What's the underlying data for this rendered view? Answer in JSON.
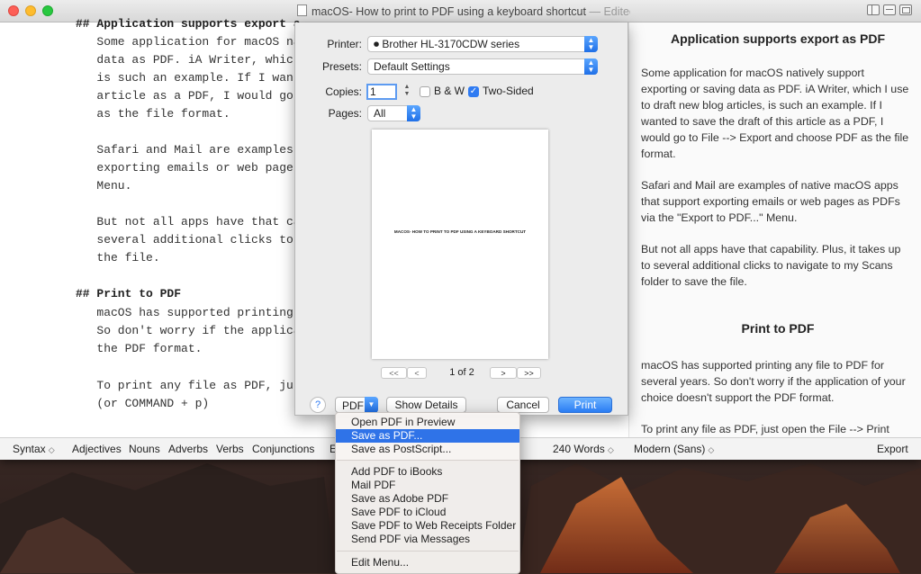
{
  "window": {
    "title": "macOS- How to print to PDF using a keyboard shortcut",
    "edited_status": "— Edited ⌄"
  },
  "editor": {
    "lines": [
      "## Application supports export a",
      "   Some application for macOS nat",
      "   data as PDF. iA Writer, which",
      "   is such an example. If I wante",
      "   article as a PDF, I would go t",
      "   as the file format.",
      "",
      "   Safari and Mail are examples o",
      "   exporting emails or web pages",
      "   Menu.",
      "",
      "   But not all apps have that cap",
      "   several additional clicks to n",
      "   the file.",
      "",
      "## Print to PDF",
      "   macOS has supported printing a",
      "   So don't worry if the applicat",
      "   the PDF format.",
      "",
      "   To print any file as PDF, just",
      "   (or COMMAND + p)"
    ]
  },
  "preview": {
    "heading1": "Application supports export as PDF",
    "para1": "Some application for macOS natively support exporting or saving data as PDF. iA Writer, which I use to draft new blog articles, is such an example. If I wanted to save the draft of this article as a PDF, I would go to File --> Export and choose PDF as the file format.",
    "para2": "Safari and Mail are examples of native macOS apps that support exporting emails or web pages as PDFs via the \"Export to PDF...\" Menu.",
    "para3": "But not all apps have that capability. Plus, it takes up to several additional clicks to navigate to my Scans folder to save the file.",
    "heading2": "Print to PDF",
    "para4": "macOS has supported printing any file to PDF for several years. So don't worry if the application of your choice doesn't support the PDF format.",
    "para5": "To print any file as PDF, just open the File --> Print"
  },
  "bottom_bar": {
    "syntax": "Syntax",
    "adjectives": "Adjectives",
    "nouns": "Nouns",
    "adverbs": "Adverbs",
    "verbs": "Verbs",
    "conjunctions": "Conjunctions",
    "cut_item": "E",
    "word_count": "240 Words",
    "font_mode": "Modern (Sans)",
    "export": "Export"
  },
  "print_dialog": {
    "printer_label": "Printer:",
    "printer_value": "Brother HL-3170CDW series",
    "presets_label": "Presets:",
    "presets_value": "Default Settings",
    "copies_label": "Copies:",
    "copies_value": "1",
    "bw_label": "B & W",
    "bw_checked": false,
    "two_sided_label": "Two-Sided",
    "two_sided_checked": true,
    "pages_label": "Pages:",
    "pages_value": "All",
    "preview_page_text": "MACOS- HOW TO PRINT TO PDF USING A KEYBOARD SHORTCUT",
    "page_indicator": "1 of 2",
    "first_page": "<<",
    "prev_page": "<",
    "next_page": ">",
    "last_page": ">>",
    "help": "?",
    "pdf_button": "PDF",
    "show_details": "Show Details",
    "cancel": "Cancel",
    "print": "Print"
  },
  "pdf_menu": {
    "items": [
      "Open PDF in Preview",
      "Save as PDF...",
      "Save as PostScript...",
      "Add PDF to iBooks",
      "Mail PDF",
      "Save as Adobe PDF",
      "Save PDF to iCloud",
      "Save PDF to Web Receipts Folder",
      "Send PDF via Messages",
      "Edit Menu..."
    ],
    "selected_index": 1
  },
  "colors": {
    "accent": "#2f73e8",
    "close": "#fd5f57",
    "minimize": "#febc2e",
    "maximize": "#28c840"
  }
}
